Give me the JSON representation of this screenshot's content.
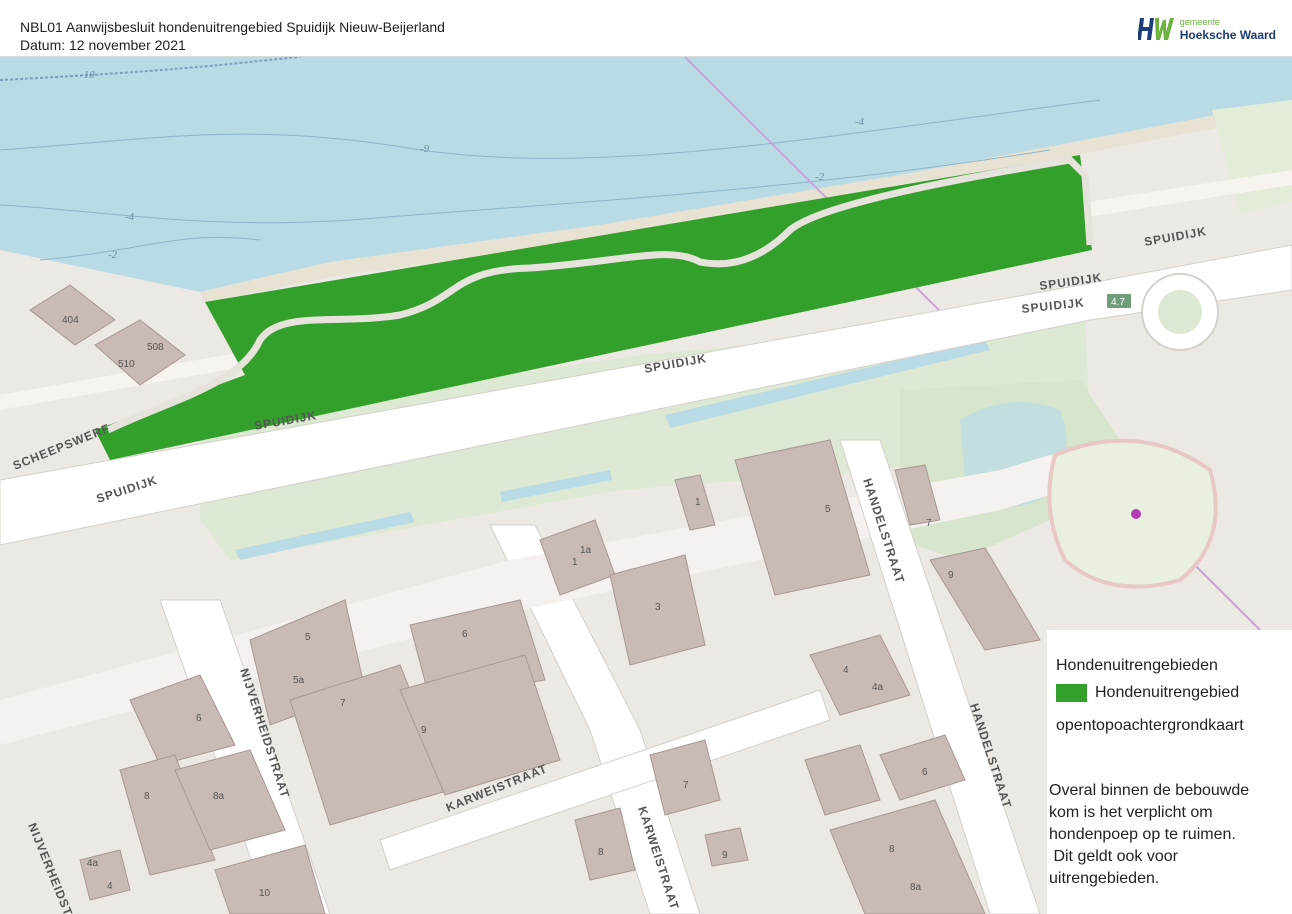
{
  "header": {
    "title": "NBL01 Aanwijsbesluit hondenuitrengebied Spuidijk Nieuw-Beijerland",
    "date": "Datum: 12 november 2021",
    "logo": {
      "small": "gemeente",
      "name": "Hoeksche Waard",
      "mark_colors": [
        "#1d3c78",
        "#6cb33f"
      ]
    }
  },
  "map": {
    "colors": {
      "water": "#b9dbe6",
      "land": "#ece9e4",
      "green": "#dde9d2",
      "road": "#ffffff",
      "building": "#c9bab6",
      "dog_area": "#33a02c"
    },
    "street_labels": [
      "SPUIDIJK",
      "SPUIDIJK",
      "SPUIDIJK",
      "SPUIDIJK",
      "SPUIDIJK",
      "SPUIDIJK",
      "SCHEEPSWERF",
      "HANDELSTRAAT",
      "HANDELSTRAAT",
      "NIJVERHEIDSTRAAT",
      "NIJVERHEIDSTRAAT",
      "KARWEISTRAAT",
      "KARWEISTRAAT"
    ],
    "house_numbers": [
      "404",
      "510",
      "508",
      "1",
      "1a",
      "3",
      "1",
      "5",
      "7",
      "9",
      "5",
      "5a",
      "6",
      "7",
      "9",
      "6",
      "8",
      "8a",
      "4a",
      "4",
      "10",
      "7",
      "8",
      "9",
      "4",
      "4a",
      "6",
      "8",
      "8a"
    ],
    "contour_labels": [
      "-10",
      "-9",
      "-4",
      "-2",
      "-2",
      "-4"
    ],
    "road_shield": "4.7"
  },
  "legend": {
    "heading": "Hondenuitrengebieden",
    "item_label": "Hondenuitrengebied",
    "item_color": "#33a02c",
    "background_label": "opentopoachtergrondkaart",
    "note_lines": [
      "Overal binnen de bebouwde",
      "kom is het verplicht om",
      "hondenpoep op te ruimen.",
      " Dit geldt ook voor",
      "uitrengebieden."
    ]
  }
}
